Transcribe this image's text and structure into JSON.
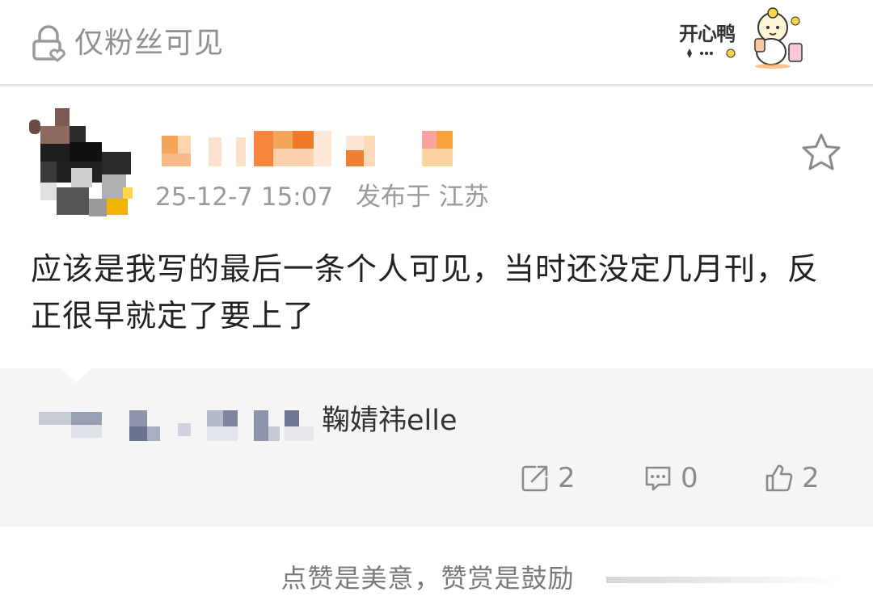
{
  "header": {
    "visibility_label": "仅粉丝可见",
    "visibility_icon": "lock-heart-icon",
    "sticker_text": "开心鸭"
  },
  "post": {
    "timestamp": "25-12-7 15:07",
    "location": "发布于 江苏",
    "content": "应该是我写的最后一条个人可见，当时还没定几月刊，反正很早就定了要上了",
    "favorite_icon": "star-outline-icon"
  },
  "retweet": {
    "name_suffix": "鞠婧祎elle"
  },
  "actions": {
    "repost_count": "2",
    "comment_count": "0",
    "like_count": "2"
  },
  "footer": {
    "reward_text": "点赞是美意，赞赏是鼓励"
  },
  "colors": {
    "muted_text": "#8f8f8f",
    "body_text": "#222222",
    "card_bg": "#ffffff",
    "quote_bg": "#f5f5f5"
  }
}
